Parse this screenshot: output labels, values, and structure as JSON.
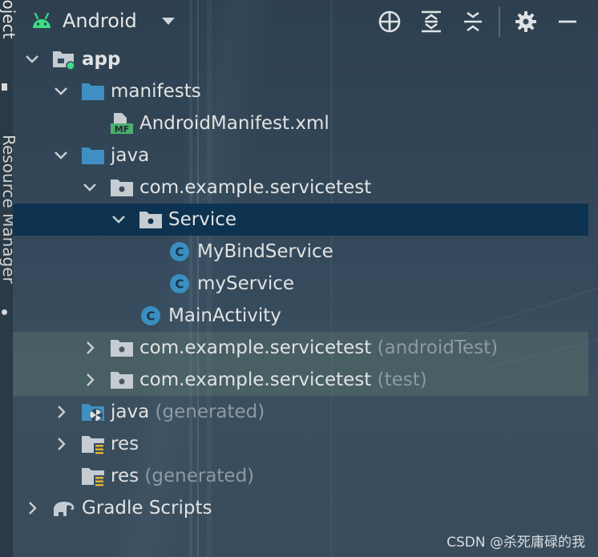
{
  "side_panel": {
    "project_label": "Project",
    "resource_label": "Resource Manager"
  },
  "toolbar": {
    "view_label": "Android",
    "icons": [
      "android-icon",
      "dropdown-caret-icon",
      "locate-icon",
      "expand-all-icon",
      "collapse-all-icon",
      "gear-icon",
      "minimize-icon"
    ]
  },
  "tree": {
    "app": "app",
    "manifests": "manifests",
    "android_manifest": "AndroidManifest.xml",
    "manifest_badge": "MF",
    "java": "java",
    "package_main": "com.example.servicetest",
    "service_folder": "Service",
    "my_bind_service": "MyBindService",
    "my_service": "myService",
    "main_activity": "MainActivity",
    "package_android_test": "com.example.servicetest",
    "android_test_suffix": "(androidTest)",
    "package_test": "com.example.servicetest",
    "test_suffix": "(test)",
    "java_generated": "java",
    "java_generated_suffix": "(generated)",
    "res": "res",
    "res_generated": "res",
    "res_generated_suffix": "(generated)",
    "gradle_scripts": "Gradle Scripts",
    "class_badge": "C"
  },
  "watermark": "CSDN @杀死庸碌的我",
  "colors": {
    "background": "#34495b",
    "selected_row": "#0d3350",
    "tinted_row": "#5b7563",
    "folder_blue": "#3f8fc4",
    "package_gray": "#c5ccd2",
    "class_badge": "#3a8ec0",
    "android_green": "#3ddc84",
    "text": "#e2e2e2",
    "muted_text": "#8e9aa3"
  }
}
